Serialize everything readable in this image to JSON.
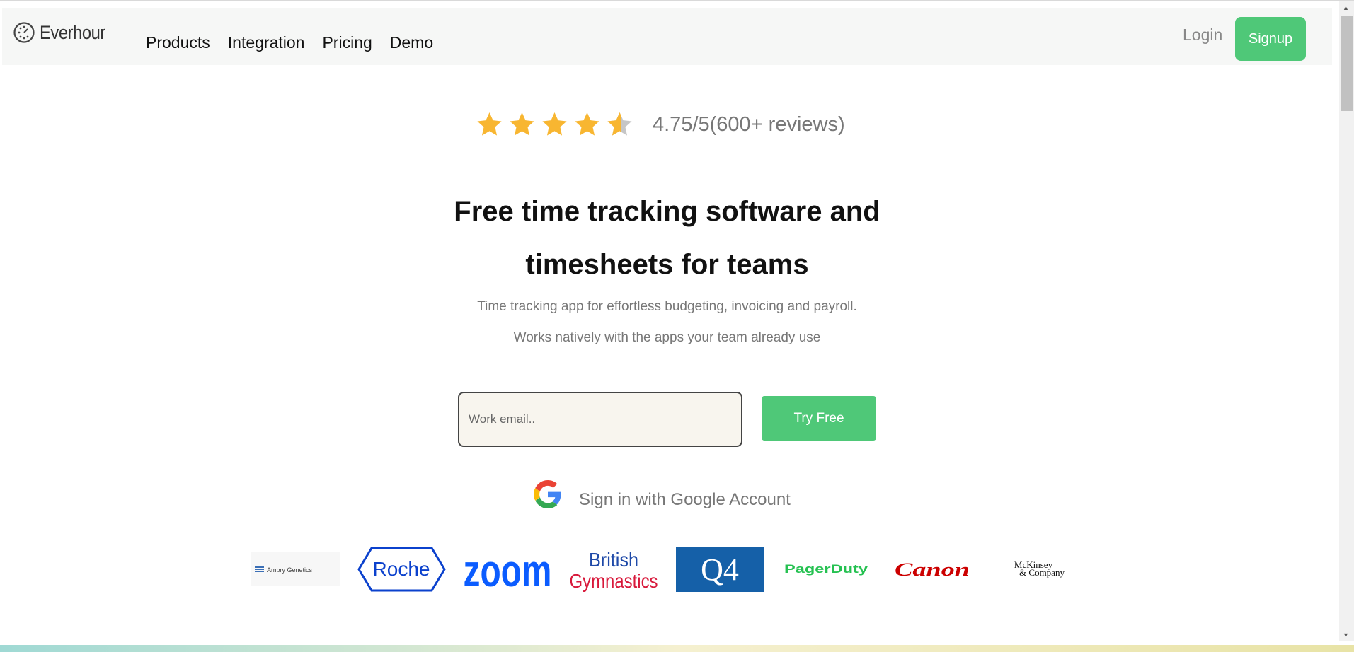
{
  "nav": {
    "brand": "Everhour",
    "links": [
      "Products",
      "Integration",
      "Pricing",
      "Demo"
    ],
    "login": "Login",
    "signup": "Signup"
  },
  "hero": {
    "rating_value": 4.75,
    "rating_max": 5,
    "rating_text": "4.75/5(600+ reviews)",
    "headline": "Free time tracking software and timesheets for teams",
    "subtitle_1": "Time tracking app for effortless budgeting, invoicing and payroll.",
    "subtitle_2": "Works natively with the apps your team already use",
    "email_placeholder": "Work email..",
    "cta": "Try Free",
    "google_signin": "Sign in with Google Account"
  },
  "customers": {
    "ambry": "Ambry Genetics",
    "roche": "Roche",
    "zoom": "zoom",
    "british_1": "British",
    "british_2": "Gymnastics",
    "q4": "Q4",
    "pagerduty": "PagerDuty",
    "canon": "Canon",
    "mckinsey_1": "McKinsey",
    "mckinsey_2": "& Company"
  },
  "colors": {
    "accent_green": "#4fc878",
    "star_gold": "#f8b631",
    "star_grey": "#c6c6c6"
  }
}
